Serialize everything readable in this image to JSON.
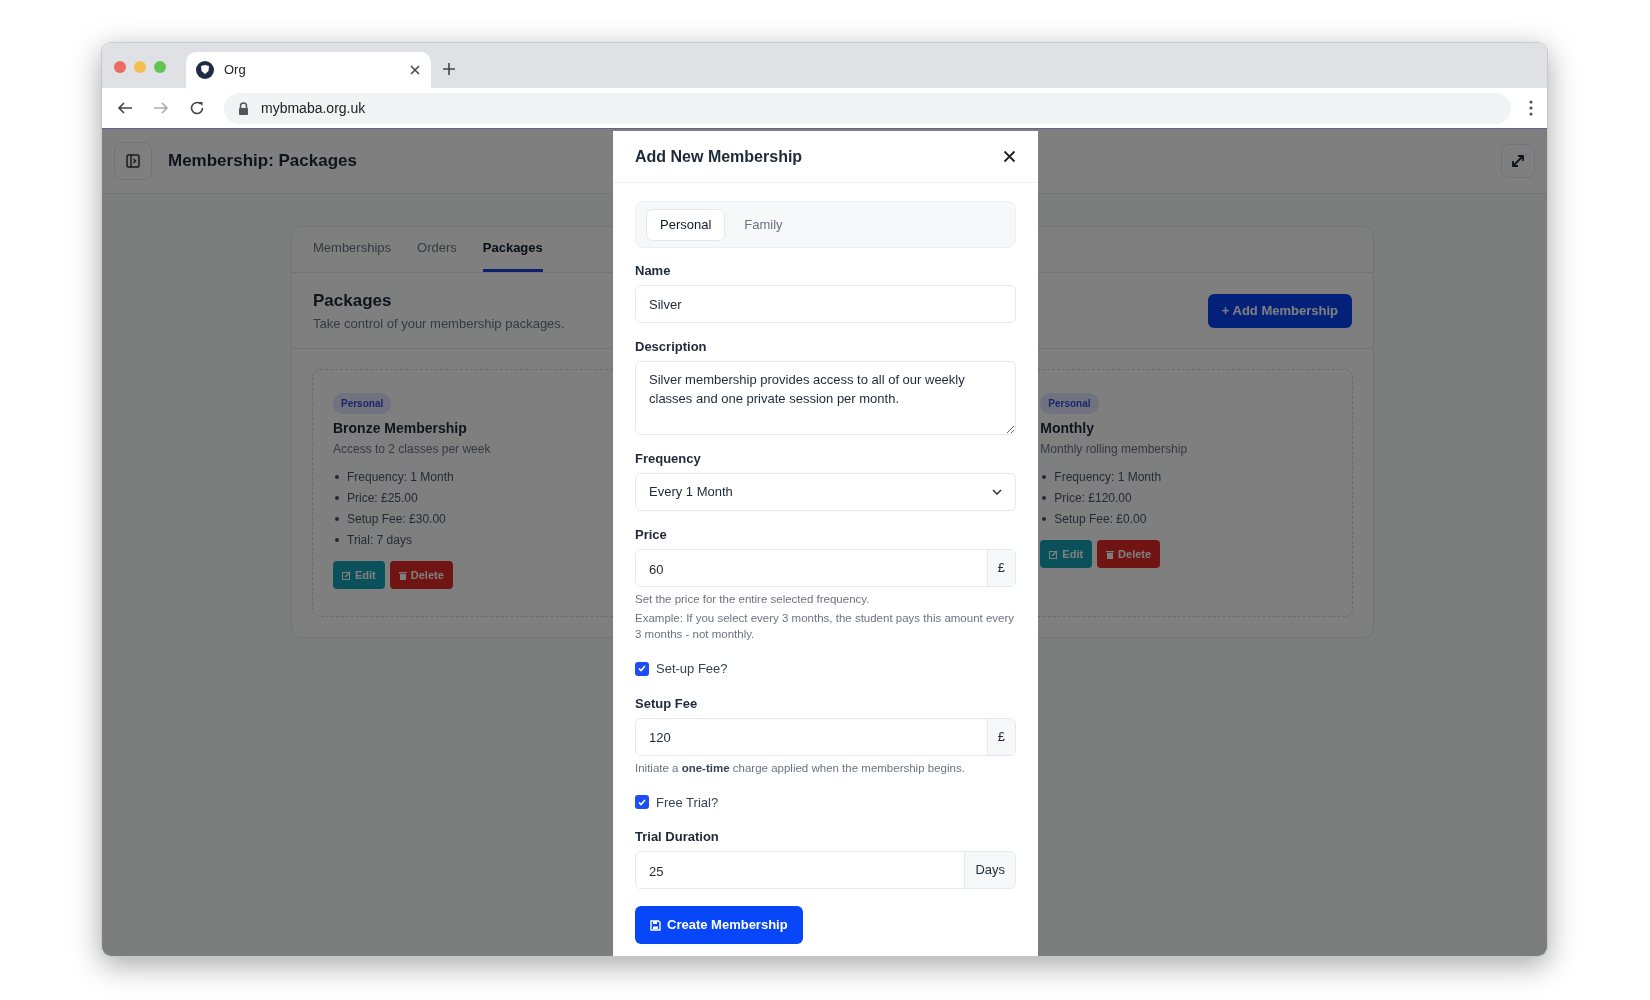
{
  "browser": {
    "tab_title": "Org",
    "url": "mybmaba.org.uk"
  },
  "header": {
    "title": "Membership: Packages"
  },
  "tabs": [
    {
      "label": "Memberships",
      "selected": false
    },
    {
      "label": "Orders",
      "selected": false
    },
    {
      "label": "Packages",
      "selected": true
    }
  ],
  "section": {
    "title": "Packages",
    "subtitle": "Take control of your membership packages.",
    "add_button": "+ Add Membership"
  },
  "packages": [
    {
      "badge": "Personal",
      "title": "Bronze Membership",
      "description": "Access to 2 classes per week",
      "details": [
        "Frequency: 1 Month",
        "Price: £25.00",
        "Setup Fee: £30.00",
        "Trial: 7 days"
      ],
      "edit": "Edit",
      "delete": "Delete"
    },
    {
      "badge": "Personal",
      "title": "Monthly",
      "description": "Monthly rolling membership",
      "details": [
        "Frequency: 1 Month",
        "Price: £120.00",
        "Setup Fee: £0.00"
      ],
      "edit": "Edit",
      "delete": "Delete"
    }
  ],
  "modal": {
    "title": "Add New Membership",
    "type_tabs": [
      {
        "label": "Personal",
        "selected": true
      },
      {
        "label": "Family",
        "selected": false
      }
    ],
    "fields": [
      {
        "kind": "text",
        "label": "Name",
        "value": "Silver"
      },
      {
        "kind": "textarea",
        "label": "Description",
        "value": "Silver membership provides access to all of our weekly classes and one private session per month."
      },
      {
        "kind": "select",
        "label": "Frequency",
        "value": "Every 1 Month"
      },
      {
        "kind": "addon",
        "label": "Price",
        "value": "60",
        "addon": "£",
        "help": [
          "Set the price for the entire selected frequency.",
          "Example: If you select every 3 months, the student pays this amount every 3 months - not monthly."
        ]
      },
      {
        "kind": "checkbox",
        "label": "Set-up Fee?",
        "checked": true
      },
      {
        "kind": "addon",
        "label": "Setup Fee",
        "value": "120",
        "addon": "£",
        "help": [
          "Initiate a **one-time** charge applied when the membership begins."
        ]
      },
      {
        "kind": "checkbox",
        "label": "Free Trial?",
        "checked": true
      },
      {
        "kind": "addon",
        "label": "Trial Duration",
        "value": "25",
        "addon": "Days"
      }
    ],
    "submit": "Create Membership"
  }
}
